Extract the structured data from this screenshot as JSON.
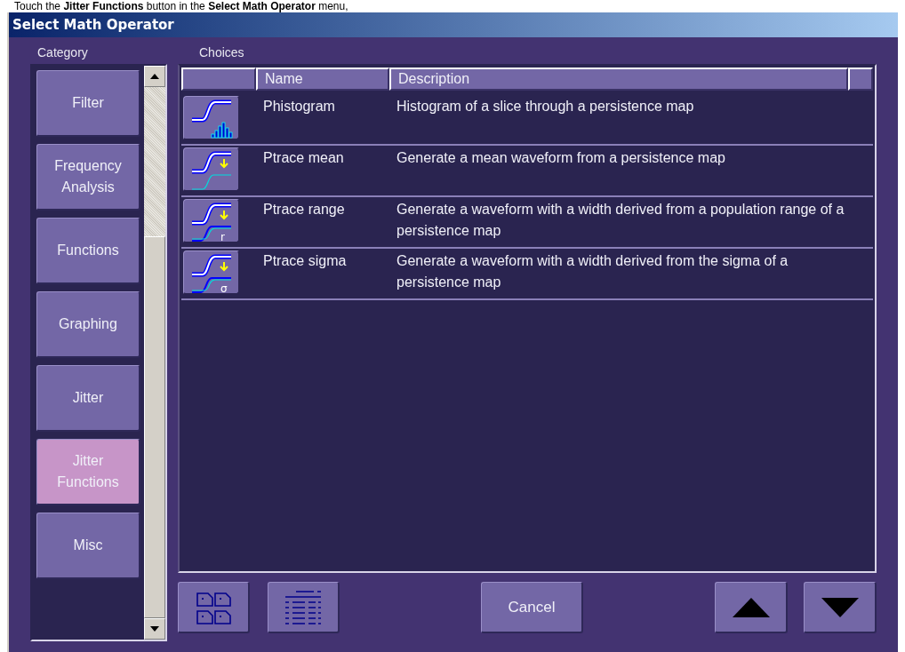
{
  "caption": "Touch the **Jitter Functions** button in the **Select Math Operator** menu,",
  "window": {
    "title": "Select Math Operator"
  },
  "category": {
    "label": "Category",
    "items": [
      {
        "label": "Filter",
        "selected": false
      },
      {
        "label": "Frequency Analysis",
        "selected": false
      },
      {
        "label": "Functions",
        "selected": false
      },
      {
        "label": "Graphing",
        "selected": false
      },
      {
        "label": "Jitter",
        "selected": false
      },
      {
        "label": "Jitter Functions",
        "selected": true
      },
      {
        "label": "Misc",
        "selected": false
      }
    ]
  },
  "choices": {
    "label": "Choices",
    "columns": [
      "Name",
      "Description"
    ],
    "rows": [
      {
        "kind": "histogram",
        "name": "Phistogram",
        "description": "Histogram of a slice through a persistence map"
      },
      {
        "kind": "mean",
        "name": "Ptrace mean",
        "description": "Generate a mean waveform from a persistence map"
      },
      {
        "kind": "range",
        "icon_label": "r",
        "name": "Ptrace range",
        "description": "Generate a waveform with a width derived from a population range of a persistence map"
      },
      {
        "kind": "sigma",
        "icon_label": "σ",
        "name": "Ptrace sigma",
        "description": "Generate a waveform with a width derived from the sigma of a persistence map"
      }
    ]
  },
  "buttons": {
    "cancel": "Cancel"
  }
}
